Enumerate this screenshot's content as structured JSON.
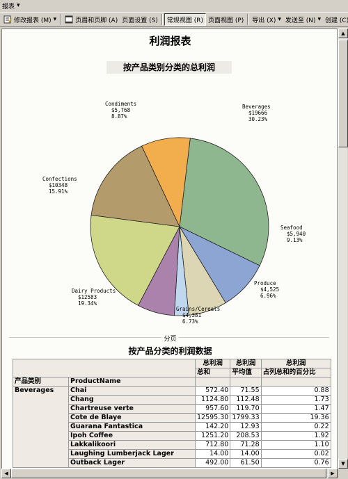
{
  "menubar": {
    "title": "报表"
  },
  "toolbar": {
    "items": [
      {
        "label": "修改报表 (M)"
      },
      {
        "label": "页眉和页脚 (A)"
      },
      {
        "label": "页面设置 (S)"
      },
      {
        "label": "常规视图 (R)"
      },
      {
        "label": "页面视图 (P)"
      },
      {
        "label": "导出 (X)"
      },
      {
        "label": "发送至 (N)"
      },
      {
        "label": "创建 (C)"
      }
    ]
  },
  "report": {
    "title": "利润报表",
    "chart_title": "按产品类别分类的总利润",
    "page_break": "分页",
    "table_title": "按产品分类的利润数据"
  },
  "chart_data": {
    "type": "pie",
    "title": "按产品类别分类的总利润",
    "slices": [
      {
        "name": "Beverages",
        "amount": "$19666",
        "pct": "30.23%",
        "value": 30.23,
        "color": "#8fb78f"
      },
      {
        "name": "Seafood",
        "amount": "$5,940",
        "pct": "9.13%",
        "value": 9.13,
        "color": "#8ca5d2"
      },
      {
        "name": "Produce",
        "amount": "$4,525",
        "pct": "6.96%",
        "value": 6.96,
        "color": "#dcd6b5"
      },
      {
        "name": "",
        "amount": "",
        "pct": "",
        "value": 2.6,
        "color": "#c0d8ef"
      },
      {
        "name": "Grains/Cereals",
        "amount": "$4,381",
        "pct": "6.73%",
        "value": 6.73,
        "color": "#aa82ac"
      },
      {
        "name": "Dairy Products",
        "amount": "$12583",
        "pct": "19.34%",
        "value": 19.34,
        "color": "#cfd888"
      },
      {
        "name": "Confections",
        "amount": "$10348",
        "pct": "15.91%",
        "value": 15.91,
        "color": "#b49b6b"
      },
      {
        "name": "Condiments",
        "amount": "$5,768",
        "pct": "8.87%",
        "value": 8.87,
        "color": "#f2ad4c"
      }
    ]
  },
  "table": {
    "header_top": [
      "总利润",
      "总利润",
      "总利润"
    ],
    "header_sub": [
      "总和",
      "平均值",
      "占列总和的百分比"
    ],
    "col_category": "产品类别",
    "col_product": "ProductName",
    "category": "Beverages",
    "rows": [
      {
        "name": "Chai",
        "sum": "572.40",
        "avg": "71.55",
        "pct": "0.88"
      },
      {
        "name": "Chang",
        "sum": "1124.80",
        "avg": "112.48",
        "pct": "1.73"
      },
      {
        "name": "Chartreuse verte",
        "sum": "957.60",
        "avg": "119.70",
        "pct": "1.47"
      },
      {
        "name": "Cote de Blaye",
        "sum": "12595.30",
        "avg": "1799.33",
        "pct": "19.36"
      },
      {
        "name": "Guarana Fantastica",
        "sum": "142.20",
        "avg": "12.93",
        "pct": "0.22"
      },
      {
        "name": "Ipoh Coffee",
        "sum": "1251.20",
        "avg": "208.53",
        "pct": "1.92"
      },
      {
        "name": "Lakkalikoori",
        "sum": "712.80",
        "avg": "71.28",
        "pct": "1.10"
      },
      {
        "name": "Laughing Lumberjack Lager",
        "sum": "14.00",
        "avg": "14.00",
        "pct": "0.02"
      },
      {
        "name": "Outback Lager",
        "sum": "492.00",
        "avg": "61.50",
        "pct": "0.76"
      }
    ]
  }
}
